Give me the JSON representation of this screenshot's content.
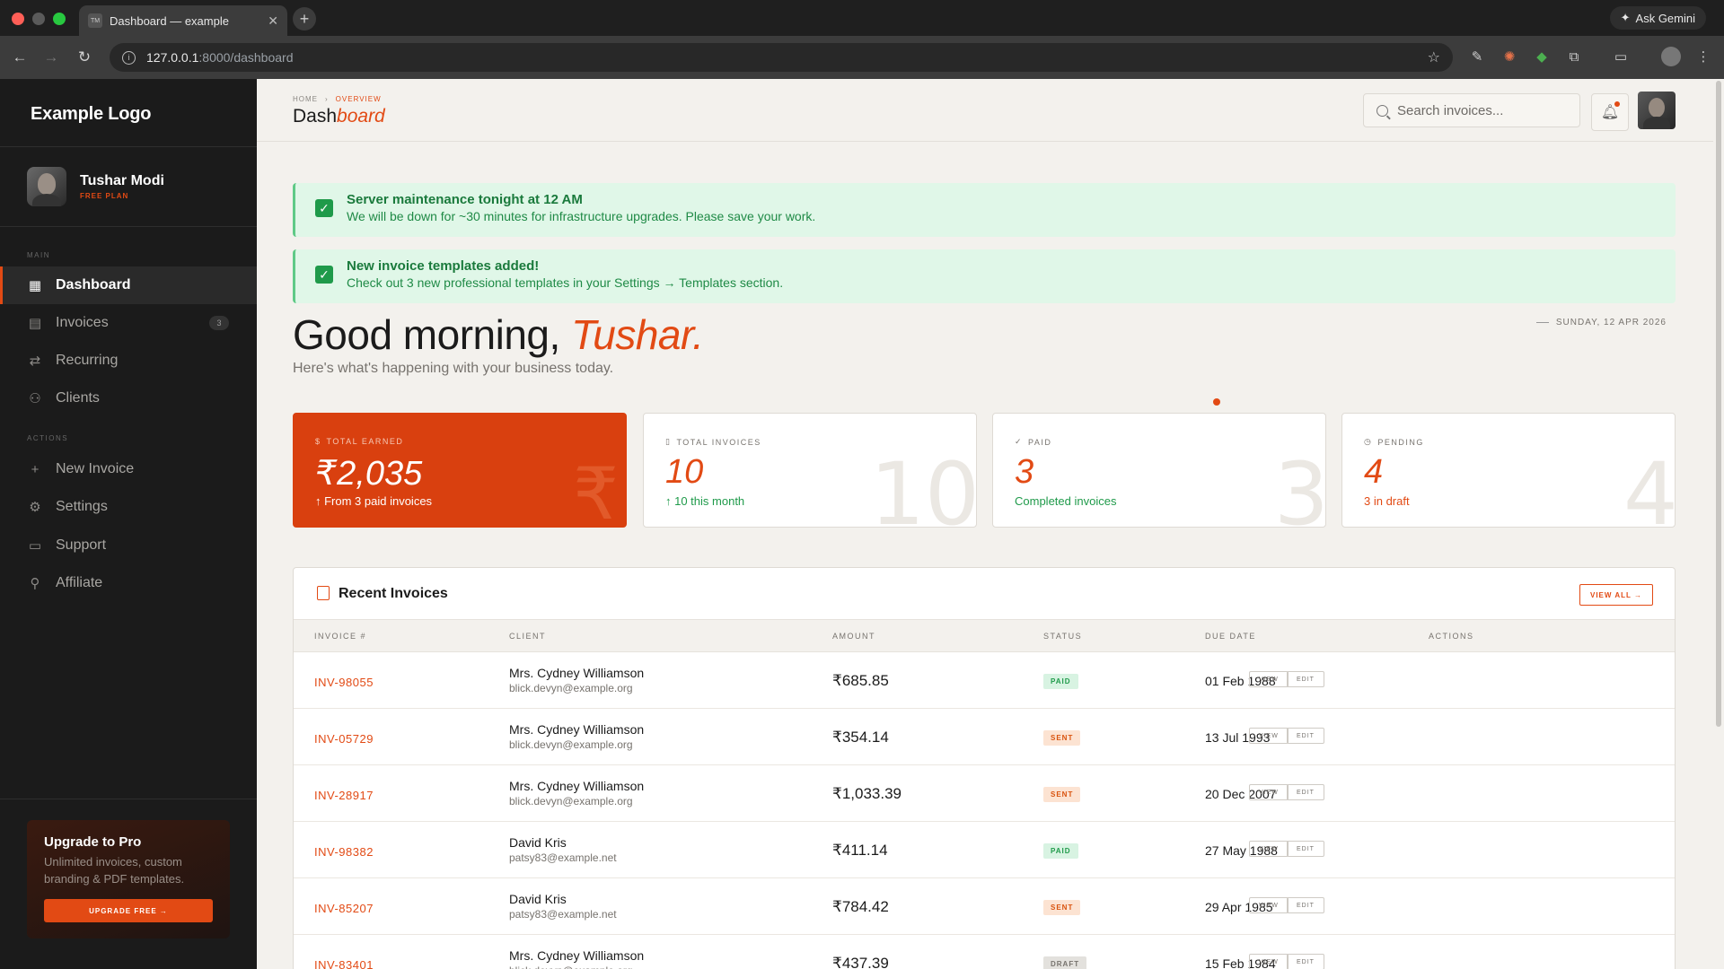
{
  "browser": {
    "tab_title": "Dashboard — example",
    "tab_favicon": "TM",
    "url_host": "127.0.0.1",
    "url_path": ":8000/dashboard",
    "ask_gemini": "Ask Gemini"
  },
  "sidebar": {
    "logo": "Example Logo",
    "user": {
      "name": "Tushar Modi",
      "plan": "FREE PLAN"
    },
    "main_label": "MAIN",
    "main_items": [
      {
        "label": "Dashboard",
        "icon": "grid-icon",
        "active": true
      },
      {
        "label": "Invoices",
        "icon": "file-icon",
        "badge": "3"
      },
      {
        "label": "Recurring",
        "icon": "repeat-icon"
      },
      {
        "label": "Clients",
        "icon": "users-icon"
      }
    ],
    "actions_label": "ACTIONS",
    "action_items": [
      {
        "label": "New Invoice",
        "icon": "plus-icon"
      },
      {
        "label": "Settings",
        "icon": "gear-icon"
      },
      {
        "label": "Support",
        "icon": "chat-icon"
      },
      {
        "label": "Affiliate",
        "icon": "user-icon"
      }
    ],
    "upgrade": {
      "title": "Upgrade to Pro",
      "desc": "Unlimited invoices, custom branding & PDF templates.",
      "button": "UPGRADE FREE →"
    }
  },
  "header": {
    "crumb_home": "HOME",
    "crumb_current": "OVERVIEW",
    "title_plain": "Dash",
    "title_italic": "board",
    "search_placeholder": "Search invoices..."
  },
  "alerts": [
    {
      "title": "Server maintenance tonight at 12 AM",
      "desc": "We will be down for ~30 minutes for infrastructure upgrades. Please save your work."
    },
    {
      "title": "New invoice templates added!",
      "desc": "Check out 3 new professional templates in your Settings → Templates section."
    }
  ],
  "greeting": {
    "text": "Good morning,",
    "name": "Tushar.",
    "sub": "Here's what's happening with your business today.",
    "date": "SUNDAY, 12 APR 2026"
  },
  "stats": [
    {
      "label": "TOTAL EARNED",
      "icon": "dollar-icon",
      "value": "₹2,035",
      "sub": "↑ From 3 paid invoices",
      "bg": "₹"
    },
    {
      "label": "TOTAL INVOICES",
      "icon": "doc-icon",
      "value": "10",
      "sub": "↑ 10 this month",
      "bg": "10",
      "sub_color": "#1f9a4a"
    },
    {
      "label": "PAID",
      "icon": "check-icon",
      "value": "3",
      "sub": "Completed invoices",
      "bg": "3",
      "sub_color": "#1f9a4a"
    },
    {
      "label": "PENDING",
      "icon": "clock-icon",
      "value": "4",
      "sub": "3 in draft",
      "bg": "4",
      "sub_color": "#e24a14"
    }
  ],
  "table": {
    "title": "Recent Invoices",
    "view_all": "VIEW ALL →",
    "columns": [
      "INVOICE #",
      "CLIENT",
      "AMOUNT",
      "STATUS",
      "DUE DATE",
      "ACTIONS"
    ],
    "view_label": "VIEW",
    "edit_label": "EDIT",
    "rows": [
      {
        "inv": "INV-98055",
        "name": "Mrs. Cydney Williamson",
        "email": "blick.devyn@example.org",
        "amount": "₹685.85",
        "status": "PAID",
        "due": "01 Feb 1988"
      },
      {
        "inv": "INV-05729",
        "name": "Mrs. Cydney Williamson",
        "email": "blick.devyn@example.org",
        "amount": "₹354.14",
        "status": "SENT",
        "due": "13 Jul 1993"
      },
      {
        "inv": "INV-28917",
        "name": "Mrs. Cydney Williamson",
        "email": "blick.devyn@example.org",
        "amount": "₹1,033.39",
        "status": "SENT",
        "due": "20 Dec 2007"
      },
      {
        "inv": "INV-98382",
        "name": "David Kris",
        "email": "patsy83@example.net",
        "amount": "₹411.14",
        "status": "PAID",
        "due": "27 May 1988"
      },
      {
        "inv": "INV-85207",
        "name": "David Kris",
        "email": "patsy83@example.net",
        "amount": "₹784.42",
        "status": "SENT",
        "due": "29 Apr 1985"
      },
      {
        "inv": "INV-83401",
        "name": "Mrs. Cydney Williamson",
        "email": "blick.devyn@example.org",
        "amount": "₹437.39",
        "status": "DRAFT",
        "due": "15 Feb 1984"
      }
    ]
  },
  "colors": {
    "accent": "#e24a14",
    "success": "#1f9a4a",
    "sidebar": "#1b1b1b",
    "background": "#f3f1ed"
  }
}
